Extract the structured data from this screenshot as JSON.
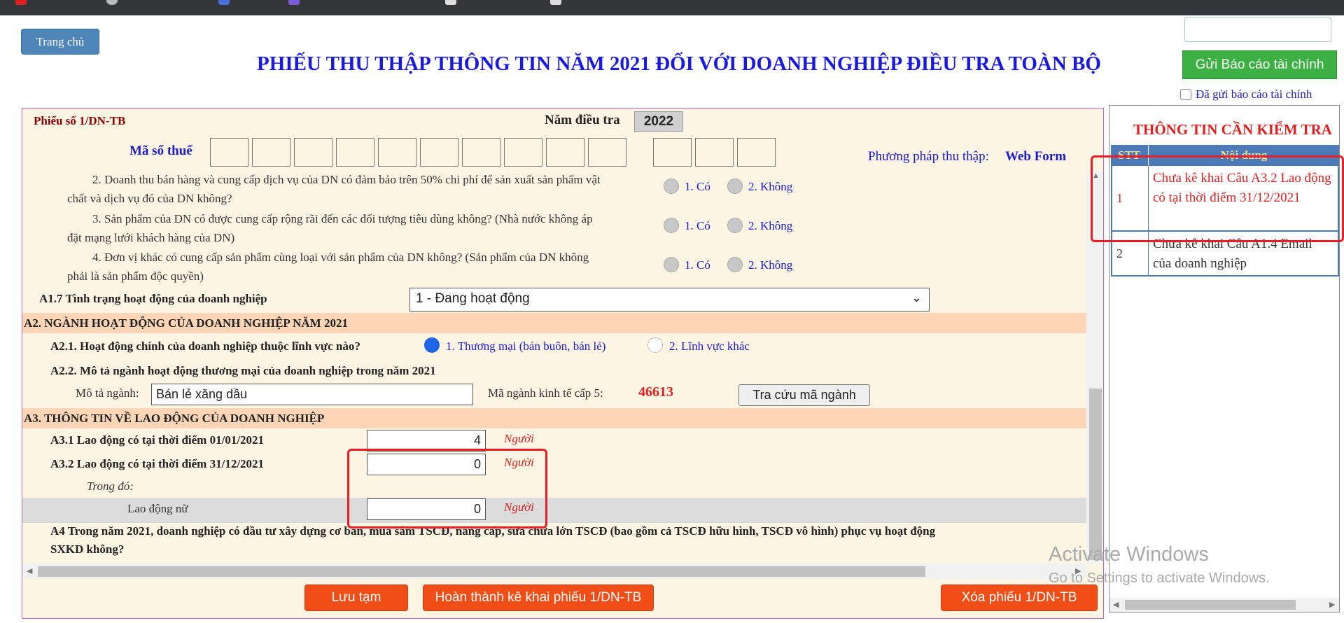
{
  "header": {
    "home_label": "Trang chủ",
    "title": "PHIẾU THU THẬP THÔNG TIN NĂM 2021 ĐỐI VỚI DOANH NGHIỆP ĐIỀU TRA TOÀN BỘ",
    "send_report_label": "Gửi Báo cáo tài chính",
    "sent_report_checkbox_label": "Đã gửi báo cáo tài chính",
    "sent_report_checked": false
  },
  "form": {
    "form_number": "Phiếu số 1/DN-TB",
    "survey_year_label": "Năm điều tra",
    "survey_year": "2022",
    "tax_code_label": "Mã số thuế",
    "method_label": "Phương pháp thu thập:",
    "method_value": "Web Form",
    "questions": [
      {
        "text_line1": "2. Doanh thu bán hàng và cung cấp dịch vụ của DN có đảm bảo trên 50% chi phí để sản xuất sản phẩm vật",
        "text_line2": "chất và dịch vụ đó của DN không?",
        "opt1": "1. Có",
        "opt2": "2. Không"
      },
      {
        "text_line1": "3. Sản phẩm của DN có được cung cấp rộng rãi đến các đối tượng tiêu dùng không? (Nhà nước không áp",
        "text_line2": "đặt mạng lưới khách hàng của DN)",
        "opt1": "1. Có",
        "opt2": "2. Không"
      },
      {
        "text_line1": "4. Đơn vị khác có cung cấp sản phẩm cùng loại với sản phẩm của DN không? (Sản phẩm của DN không",
        "text_line2": "phải là sản phẩm độc quyền)",
        "opt1": "1. Có",
        "opt2": "2. Không"
      }
    ],
    "a17_label": "A1.7 Tình trạng hoạt động của doanh nghiệp",
    "a17_value": "1 - Đang hoạt động",
    "a2_section": "A2. NGÀNH HOẠT ĐỘNG CỦA DOANH NGHIỆP NĂM 2021",
    "a21_label": "A2.1. Hoạt động chính của doanh nghiệp thuộc lĩnh vực nào?",
    "a21_opt1": "1. Thương mại (bán buôn, bán lẻ)",
    "a21_opt2": "2. Lĩnh vực khác",
    "a22_label": "A2.2. Mô tả ngành hoạt động thương mại của doanh nghiệp trong năm 2021",
    "industry_desc_label": "Mô tả ngành:",
    "industry_desc_value": "Bán lẻ xăng dầu",
    "industry_code_label": "Mã ngành kinh tế cấp 5:",
    "industry_code_value": "46613",
    "lookup_label": "Tra cứu mã ngành",
    "a3_section": "A3. THÔNG TIN VỀ LAO ĐỘNG CỦA DOANH NGHIỆP",
    "a31_label": "A3.1 Lao động có tại thời điểm 01/01/2021",
    "a31_value": "4",
    "a32_label": "A3.2 Lao động có tại thời điểm 31/12/2021",
    "a32_value": "0",
    "of_which_label": "Trong đó:",
    "female_label": "Lao động nữ",
    "female_value": "0",
    "unit": "Người",
    "a4_line1": "A4 Trong năm 2021, doanh nghiệp có đầu tư xây dựng cơ bản, mua sắm TSCĐ, nâng cấp, sửa chữa lớn TSCĐ (bao gồm cả TSCĐ hữu hình, TSCĐ vô hình) phục vụ hoạt động",
    "a4_line2": "SXKD không?"
  },
  "actions": {
    "save_draft": "Lưu tạm",
    "complete": "Hoàn thành kê khai phiếu 1/DN-TB",
    "delete": "Xóa phiếu 1/DN-TB"
  },
  "check_panel": {
    "title": "THÔNG TIN CẦN KIỂM TRA",
    "col_stt": "STT",
    "col_content": "Nội dung",
    "rows": [
      {
        "stt": "1",
        "content": "Chưa kê khai Câu A3.2 Lao động có tại thời điểm 31/12/2021"
      },
      {
        "stt": "2",
        "content": "Chưa kê khai Câu A1.4 Email của doanh nghiệp"
      }
    ]
  },
  "windows_watermark": {
    "line1": "Activate Windows",
    "line2": "Go to Settings to activate Windows."
  },
  "colors": {
    "title_blue": "#1a1adf",
    "green_button": "#3cb043",
    "orange_button": "#f04d17",
    "section_band": "#fbd5b5",
    "form_bg": "#fdf5e3",
    "alert_red": "#e02020",
    "panel_header": "#4b7ab6"
  }
}
